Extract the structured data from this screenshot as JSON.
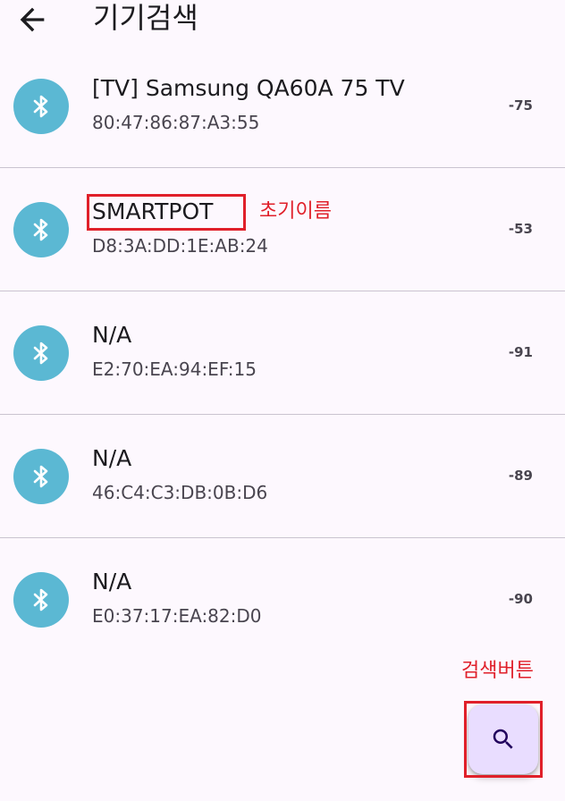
{
  "appbar": {
    "title": "기기검색",
    "back_icon": "arrow-back-icon"
  },
  "devices": [
    {
      "name": "[TV] Samsung QA60A 75 TV",
      "mac": "80:47:86:87:A3:55",
      "rssi": "-75",
      "icon": "bluetooth-icon"
    },
    {
      "name": "SMARTPOT",
      "mac": "D8:3A:DD:1E:AB:24",
      "rssi": "-53",
      "icon": "bluetooth-icon"
    },
    {
      "name": "N/A",
      "mac": "E2:70:EA:94:EF:15",
      "rssi": "-91",
      "icon": "bluetooth-icon"
    },
    {
      "name": "N/A",
      "mac": "46:C4:C3:DB:0B:D6",
      "rssi": "-89",
      "icon": "bluetooth-icon"
    },
    {
      "name": "N/A",
      "mac": "E0:37:17:EA:82:D0",
      "rssi": "-90",
      "icon": "bluetooth-icon"
    }
  ],
  "annotations": {
    "initial_name_label": "초기이름",
    "search_button_label": "검색버튼"
  },
  "fab": {
    "icon": "search-icon"
  },
  "colors": {
    "background": "#fdf8fe",
    "avatar": "#5bb8d3",
    "fab": "#e9ddff",
    "annotation": "#e0202a"
  }
}
